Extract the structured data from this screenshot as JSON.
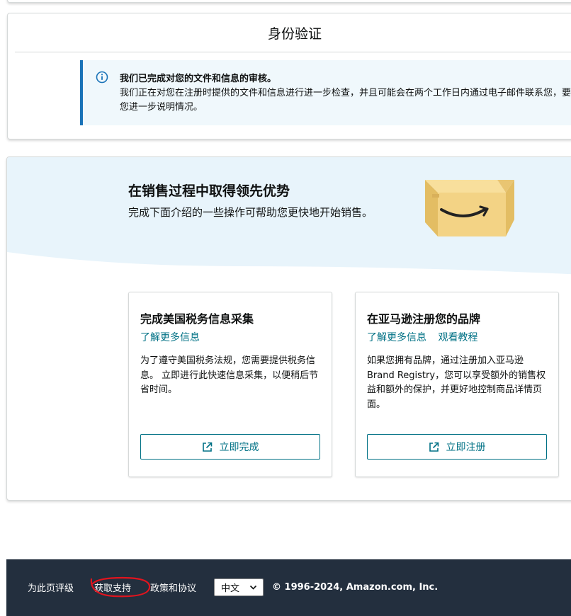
{
  "verification": {
    "title": "身份验证",
    "alert_heading": "我们已完成对您的文件和信息的审核。",
    "alert_body": "我们正在对您在注册时提供的文件和信息进行进一步检查，并且可能会在两个工作日内通过电子邮件联系您，要求您进一步说明情况。",
    "alert_icon": "info-icon",
    "accent_color": "#1a73b8"
  },
  "promo": {
    "title": "在销售过程中取得领先优势",
    "subtitle": "完成下面介绍的一些操作可帮助您更快地开始销售。",
    "illustration": "amazon-box-icon",
    "bg_color": "#e8f4fb"
  },
  "tasks": [
    {
      "title": "完成美国税务信息采集",
      "links": [
        "了解更多信息"
      ],
      "description": "为了遵守美国税务法规，您需要提供税务信息。 立即进行此快速信息采集，以便稍后节省时间。",
      "button_label": "立即完成",
      "button_icon": "external-link-icon"
    },
    {
      "title": "在亚马逊注册您的品牌",
      "links": [
        "了解更多信息",
        "观看教程"
      ],
      "description": "如果您拥有品牌，通过注册加入亚马逊 Brand Registry，您可以享受额外的销售权益和额外的保护，并更好地控制商品详情页面。",
      "button_label": "立即注册",
      "button_icon": "external-link-icon"
    }
  ],
  "footer": {
    "rate_page": "为此页评级",
    "get_support": "获取支持",
    "policies": "政策和协议",
    "language": "中文",
    "copyright": "© 1996-2024, Amazon.com, Inc.",
    "bg_color": "#232f3e",
    "annotation_color": "#e0141e"
  }
}
